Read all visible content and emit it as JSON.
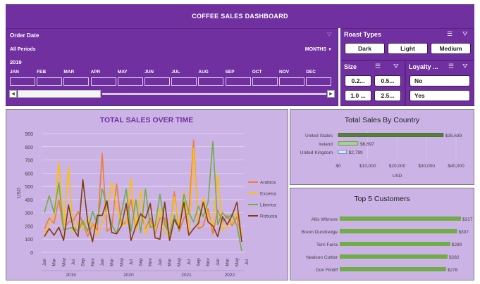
{
  "header": {
    "title": "COFFEE  SALES DASHBOARD"
  },
  "timeline": {
    "label": "Order Date",
    "period_text": "All Periods",
    "view_selector": "MONTHS",
    "year": "2019",
    "months": [
      "JAN",
      "FEB",
      "MAR",
      "APR",
      "MAY",
      "JUN",
      "JUL",
      "AUG",
      "SEP",
      "OCT",
      "NOV",
      "DEC"
    ]
  },
  "slicers": {
    "roast": {
      "title": "Roast Types",
      "items": [
        "Dark",
        "Light",
        "Medium"
      ]
    },
    "size": {
      "title": "Size",
      "items": [
        "0.2...",
        "0.5...",
        "1.0 ...",
        "2.5..."
      ]
    },
    "loyalty": {
      "title": "Loyalty ...",
      "items": [
        "No",
        "Yes"
      ]
    }
  },
  "colors": {
    "purple": "#7030a0",
    "panel": "#cbb3e6",
    "arabica": "#ed7d31",
    "excelsa": "#ffc000",
    "liberica": "#70ad47",
    "robusta": "#843c0c",
    "country_bar": "#548235"
  },
  "chart_data": [
    {
      "type": "line",
      "title": "TOTAL SALES OVER TIME",
      "ylabel": "USD",
      "ylim": [
        0,
        900
      ],
      "yticks": [
        0,
        100,
        200,
        300,
        400,
        500,
        600,
        700,
        800,
        900
      ],
      "x_month_labels": [
        "Jan",
        "Mar",
        "May",
        "Jul",
        "Sep",
        "Nov",
        "Jan",
        "Mar",
        "May",
        "Jul",
        "Sep",
        "Nov",
        "Jan",
        "Mar",
        "May",
        "Jul",
        "Sep",
        "Nov",
        "Jan",
        "Mar",
        "May",
        "Jul"
      ],
      "x_year_labels": [
        "2019",
        "2020",
        "2021",
        "2022"
      ],
      "legend_position": "right",
      "series": [
        {
          "name": "Arabica",
          "values": [
            180,
            260,
            220,
            400,
            170,
            230,
            240,
            310,
            220,
            120,
            220,
            170,
            750,
            160,
            190,
            520,
            210,
            230,
            400,
            170,
            300,
            180,
            260,
            140,
            260,
            260,
            120,
            460,
            160,
            260,
            300,
            850,
            180,
            200,
            330,
            140,
            320,
            230,
            280,
            200,
            270,
            100
          ]
        },
        {
          "name": "Excelsa",
          "values": [
            130,
            220,
            270,
            680,
            180,
            650,
            150,
            240,
            180,
            260,
            210,
            130,
            220,
            320,
            530,
            350,
            200,
            220,
            560,
            170,
            470,
            140,
            220,
            180,
            330,
            150,
            130,
            420,
            200,
            460,
            140,
            790,
            200,
            410,
            280,
            190,
            590,
            170,
            200,
            230,
            300,
            140
          ]
        },
        {
          "name": "Liberica",
          "values": [
            300,
            430,
            300,
            530,
            170,
            180,
            190,
            160,
            240,
            160,
            310,
            220,
            480,
            350,
            210,
            140,
            300,
            480,
            160,
            400,
            150,
            480,
            190,
            200,
            440,
            210,
            140,
            280,
            170,
            440,
            300,
            230,
            350,
            270,
            380,
            840,
            210,
            300,
            260,
            290,
            200,
            10
          ]
        },
        {
          "name": "Robusta",
          "values": [
            120,
            180,
            130,
            190,
            90,
            360,
            180,
            120,
            550,
            230,
            80,
            280,
            280,
            390,
            150,
            140,
            200,
            370,
            90,
            200,
            290,
            260,
            370,
            110,
            100,
            380,
            90,
            250,
            180,
            380,
            130,
            180,
            220,
            380,
            230,
            200,
            120,
            270,
            210,
            280,
            380,
            80
          ]
        }
      ]
    },
    {
      "type": "bar",
      "title": "Total  Sales By Country",
      "xlabel": "USD",
      "categories": [
        "United States",
        "Ireland",
        "United Kingdom"
      ],
      "values": [
        35639,
        6697,
        2799
      ],
      "value_labels": [
        "$35,639",
        "$6,697",
        "$2,799"
      ],
      "xlim": [
        0,
        40000
      ],
      "xticks": [
        "$0",
        "$10,000",
        "$20,000",
        "$30,000",
        "$40,000"
      ]
    },
    {
      "type": "bar",
      "title": "Top 5 Customers",
      "categories": [
        "Allis Wilmore",
        "Brenn Dundredge",
        "Terri Farra",
        "Nealson Cuttler",
        "Don Flintiff"
      ],
      "values": [
        317,
        307,
        289,
        282,
        278
      ],
      "value_labels": [
        "$317",
        "$307",
        "$289",
        "$282",
        "$278"
      ]
    }
  ]
}
